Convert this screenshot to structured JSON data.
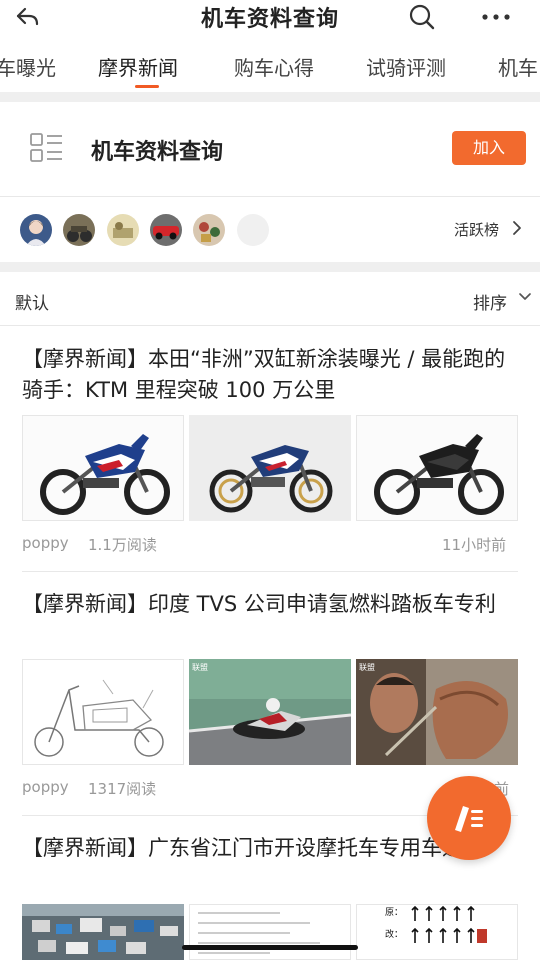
{
  "header": {
    "title": "机车资料查询"
  },
  "tabs": [
    {
      "label": "车曝光"
    },
    {
      "label": "摩界新闻"
    },
    {
      "label": "购车心得"
    },
    {
      "label": "试骑评测"
    },
    {
      "label": "机车"
    }
  ],
  "active_tab": "摩界新闻",
  "group": {
    "name": "机车资料查询",
    "join_label": "加入"
  },
  "active_rank_label": "活跃榜",
  "sort": {
    "default_label": "默认",
    "sort_label": "排序"
  },
  "posts": [
    {
      "title": "【摩界新闻】本田“非洲”双缸新涂装曝光 / 最能跑的骑手：KTM 里程突破 100 万公里",
      "author": "poppy",
      "views": "1.1万阅读",
      "time": "11小时前"
    },
    {
      "title": "【摩界新闻】印度 TVS 公司申请氢燃料踏板车专利",
      "author": "poppy",
      "views": "1317阅读",
      "time": "前",
      "image_tags": [
        "联盟",
        "联盟"
      ]
    },
    {
      "title": "【摩界新闻】广东省江门市开设摩托车专用车道",
      "doc_labels": [
        "原：",
        "改："
      ]
    }
  ],
  "colors": {
    "accent": "#f26a2e",
    "divider": "#efefef"
  }
}
